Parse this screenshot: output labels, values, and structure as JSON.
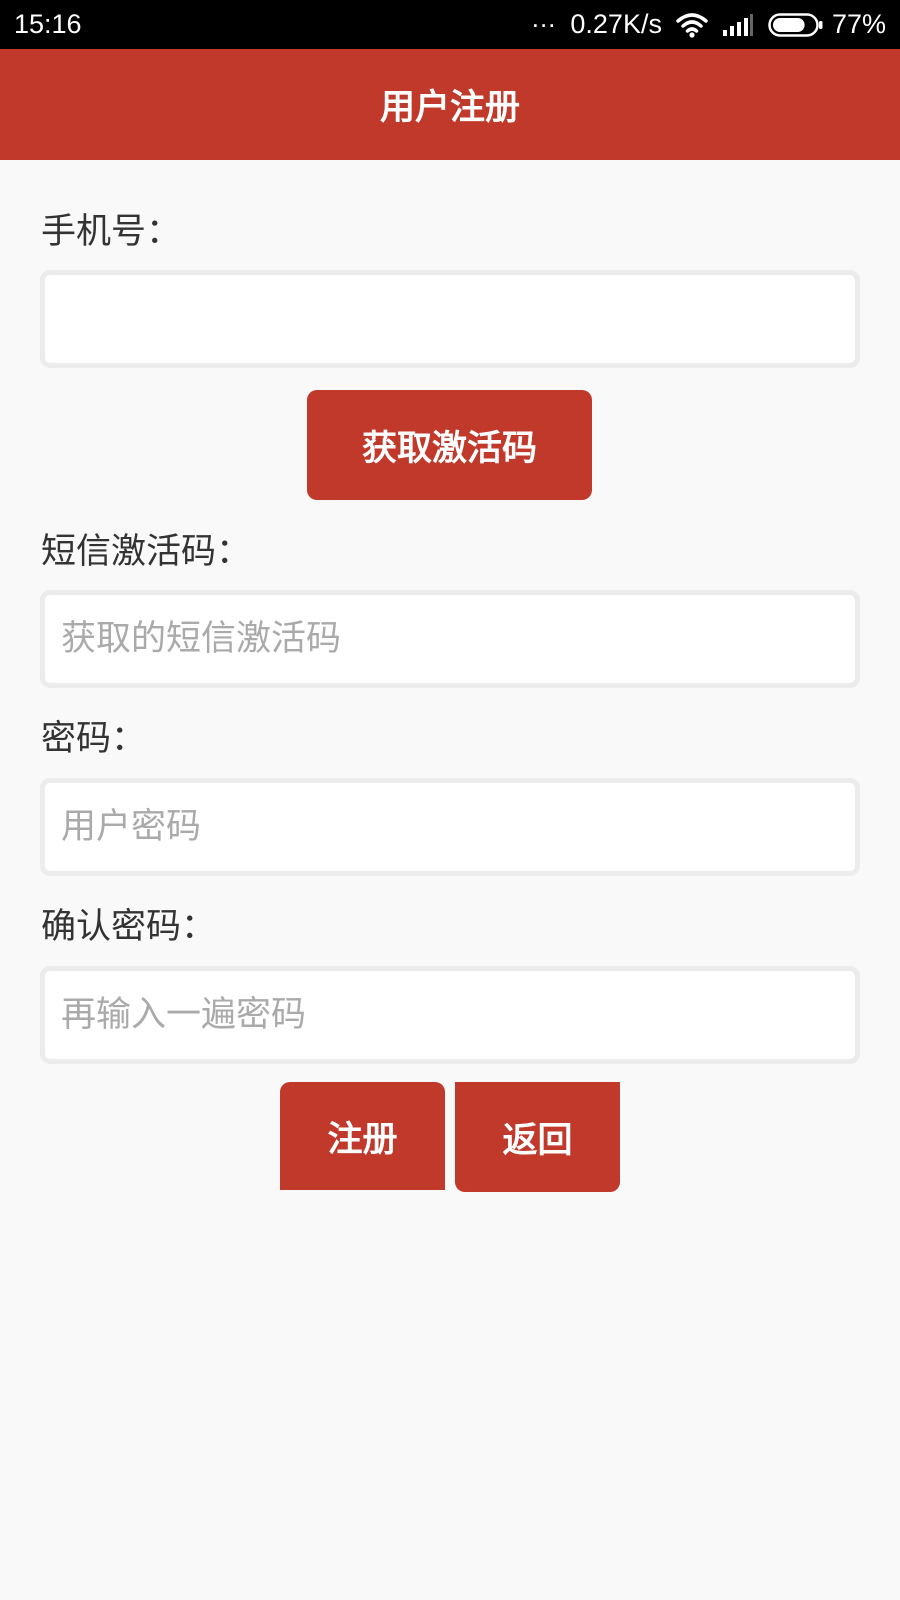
{
  "status_bar": {
    "time": "15:16",
    "dots": "...",
    "network_speed": "0.27K/s",
    "wifi_icon": "wifi-icon",
    "signal_icon": "signal-icon",
    "battery_icon": "battery-icon",
    "battery_percent": "77%",
    "battery_level": 0.77
  },
  "header": {
    "title": "用户注册"
  },
  "form": {
    "phone": {
      "label": "手机号：",
      "value": "",
      "placeholder": ""
    },
    "get_code_label": "获取激活码",
    "sms_code": {
      "label": "短信激活码：",
      "value": "",
      "placeholder": "获取的短信激活码"
    },
    "password": {
      "label": "密码：",
      "value": "",
      "placeholder": "用户密码"
    },
    "confirm_password": {
      "label": "确认密码：",
      "value": "",
      "placeholder": "再输入一遍密码"
    },
    "register_label": "注册",
    "back_label": "返回"
  },
  "colors": {
    "accent": "#c0392b",
    "background": "#f9f9f9",
    "status_bar": "#000000",
    "text": "#333333",
    "placeholder": "#aaaaaa",
    "input_border": "#ececec"
  }
}
